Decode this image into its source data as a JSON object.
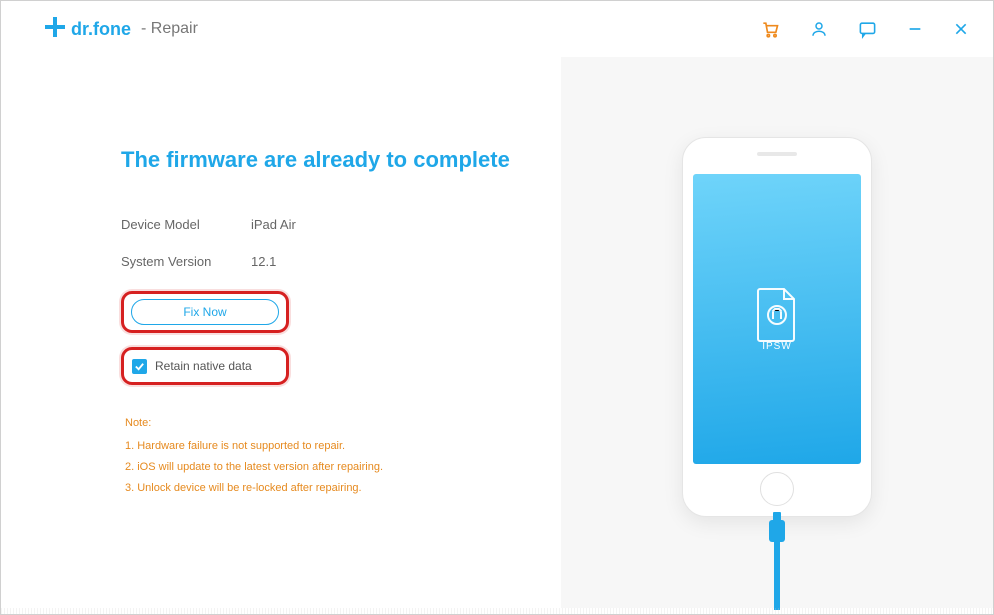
{
  "app": {
    "brand": "dr.fone",
    "section": "- Repair"
  },
  "main": {
    "heading": "The firmware are already to complete",
    "device_model_label": "Device Model",
    "device_model_value": "iPad Air",
    "system_version_label": "System Version",
    "system_version_value": "12.1",
    "fix_button_label": "Fix Now",
    "retain_checkbox_label": "Retain native data",
    "retain_checked": true,
    "notes_heading": "Note:",
    "notes": [
      "1. Hardware failure is not supported to repair.",
      "2. iOS will update to the latest version after repairing.",
      "3. Unlock device will be re-locked after repairing."
    ]
  },
  "phone": {
    "file_label": "IPSW"
  },
  "colors": {
    "accent": "#1fa7e8",
    "highlight": "#d62020",
    "warn": "#e68a1f"
  }
}
